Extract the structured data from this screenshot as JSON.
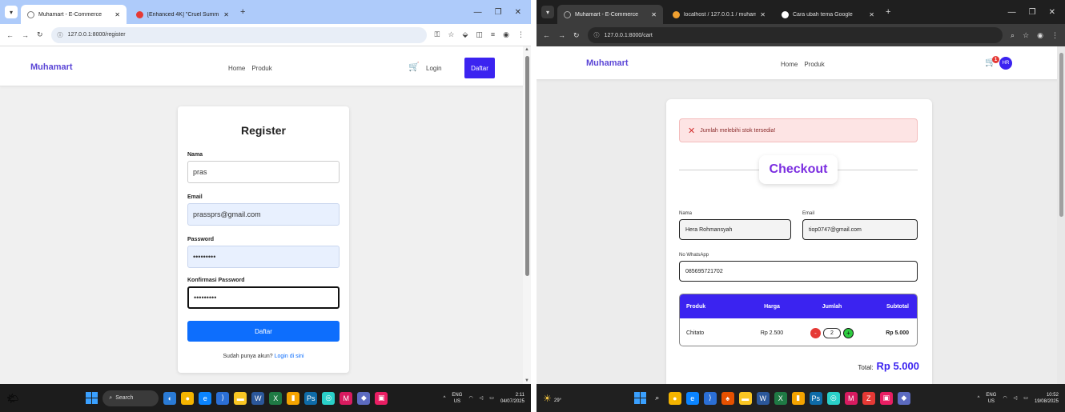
{
  "left": {
    "tabs": [
      {
        "label": "Muhamart - E-Commerce",
        "active": true
      },
      {
        "label": "[Enhanced 4K] \"Cruel Summ",
        "active": false
      }
    ],
    "url": "127.0.0.1:8000/register",
    "nav": {
      "brand": "Muhamart",
      "home": "Home",
      "produk": "Produk",
      "login": "Login",
      "daftar": "Daftar"
    },
    "form": {
      "title": "Register",
      "nama_label": "Nama",
      "nama_value": "pras",
      "email_label": "Email",
      "email_value": "prassprs@gmail.com",
      "password_label": "Password",
      "password_value": "•••••••••",
      "confirm_label": "Konfirmasi Password",
      "confirm_value": "•••••••••",
      "submit_label": "Daftar",
      "footer_text": "Sudah punya akun?",
      "footer_link": "Login di sini"
    },
    "taskbar": {
      "search": "Search",
      "lang1": "ENG",
      "lang2": "US",
      "time": "2:11",
      "date": "04/07/2025"
    }
  },
  "right": {
    "tabs": [
      {
        "label": "Muhamart - E-Commerce",
        "active": true
      },
      {
        "label": "localhost / 127.0.0.1 / muhama",
        "active": false
      },
      {
        "label": "Cara ubah tema Google",
        "active": false
      }
    ],
    "url": "127.0.0.1:8000/cart",
    "nav": {
      "brand": "Muhamart",
      "home": "Home",
      "produk": "Produk",
      "cart_count": "1",
      "avatar": "HR"
    },
    "alert": "Jumlah melebihi stok tersedia!",
    "title": "Checkout",
    "form": {
      "nama_label": "Nama",
      "nama_value": "Hera Rohmansyah",
      "email_label": "Email",
      "email_value": "tiop0747@gmail.com",
      "wa_label": "No WhatsApp",
      "wa_value": "085695721702"
    },
    "table": {
      "headers": [
        "Produk",
        "Harga",
        "Jumlah",
        "Subtotal"
      ],
      "rows": [
        {
          "produk": "Chitato",
          "harga": "Rp 2.500",
          "jumlah": "2",
          "subtotal": "Rp 5.000"
        }
      ]
    },
    "total_label": "Total:",
    "total_value": "Rp 5.000",
    "taskbar": {
      "temp": "29°",
      "lang1": "ENG",
      "lang2": "US",
      "time": "10:52",
      "date": "19/08/2025"
    }
  },
  "colors": {
    "primary": "#3b23f0",
    "brand": "#5b46d6",
    "button_blue": "#0d6efd",
    "checkout_title": "#7b2ee0",
    "alert_bg": "#fde4e4"
  }
}
